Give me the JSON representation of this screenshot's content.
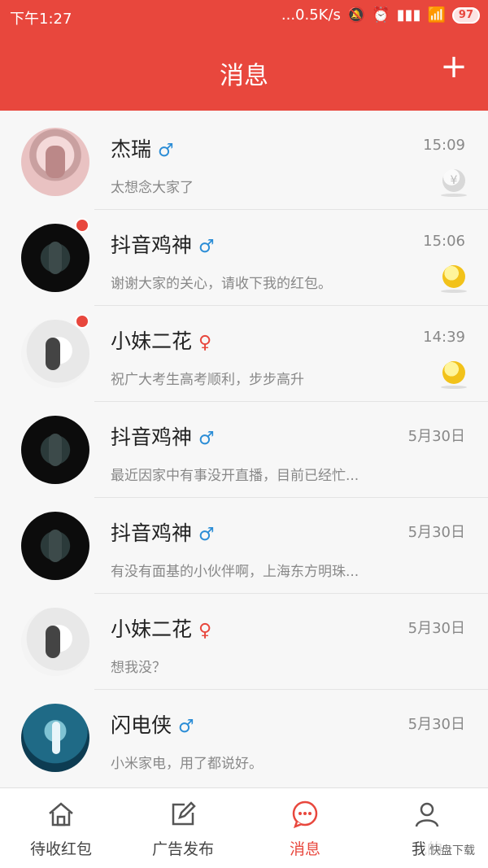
{
  "status": {
    "time": "下午1:27",
    "net": "...0.5K/s",
    "battery": "97"
  },
  "header": {
    "title": "消息",
    "add": "+"
  },
  "messages": [
    {
      "name": "杰瑞",
      "gender": "♂",
      "time": "15:09",
      "text": "太想念大家了"
    },
    {
      "name": "抖音鸡神",
      "gender": "♂",
      "time": "15:06",
      "text": "谢谢大家的关心，请收下我的红包。"
    },
    {
      "name": "小妹二花",
      "gender": "♀",
      "time": "14:39",
      "text": "祝广大考生高考顺利，步步高升"
    },
    {
      "name": "抖音鸡神",
      "gender": "♂",
      "time": "5月30日",
      "text": "最近因家中有事没开直播，目前已经忙..."
    },
    {
      "name": "抖音鸡神",
      "gender": "♂",
      "time": "5月30日",
      "text": "有没有面基的小伙伴啊，上海东方明珠..."
    },
    {
      "name": "小妹二花",
      "gender": "♀",
      "time": "5月30日",
      "text": "想我没？"
    },
    {
      "name": "闪电侠",
      "gender": "♂",
      "time": "5月30日",
      "text": "小米家电，用了都说好。"
    }
  ],
  "coin": {
    "gray_symbol": "¥"
  },
  "nav": [
    {
      "label": "待收红包"
    },
    {
      "label": "广告发布"
    },
    {
      "label": "消息"
    },
    {
      "label": "我的"
    }
  ],
  "watermark": "快盘下载"
}
